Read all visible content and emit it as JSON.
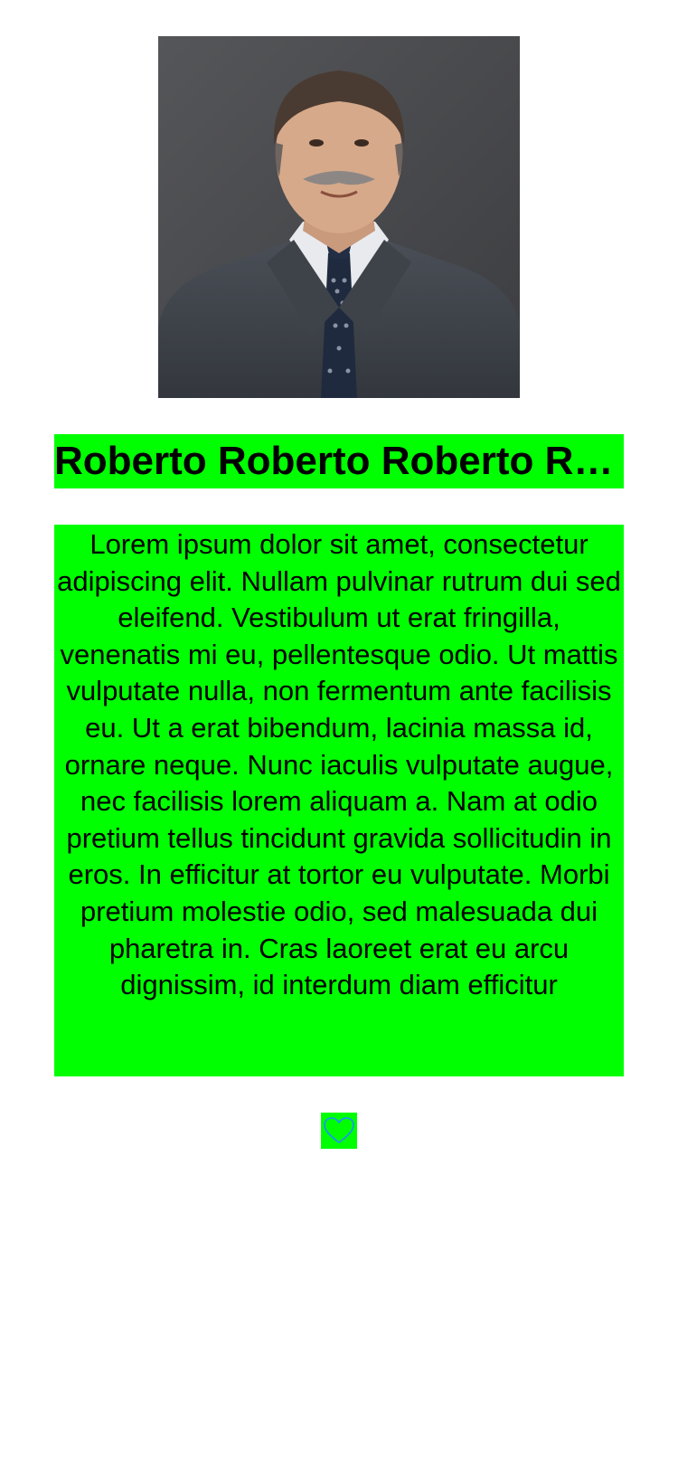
{
  "profile": {
    "photo_alt": "profile photo",
    "name": "Roberto Roberto Roberto Roberto",
    "bio": "Lorem ipsum dolor sit amet, consectetur adipiscing elit. Nullam pulvinar rutrum dui sed eleifend. Vestibulum ut erat fringilla, venenatis mi eu, pellentesque odio. Ut mattis vulputate nulla, non fermentum ante facilisis eu. Ut a erat bibendum, lacinia massa id, ornare neque. Nunc iaculis vulputate augue, nec facilisis lorem aliquam a. Nam at odio pretium tellus tincidunt gravida sollicitudin in eros. In efficitur at tortor eu vulputate. Morbi pretium molestie odio, sed malesuada dui pharetra in. Cras laoreet erat eu arcu dignissim, id interdum diam efficitur"
  },
  "like_button": {
    "icon": "heart-outline-icon",
    "icon_color": "#1e90ff"
  },
  "colors": {
    "highlight": "#00ff00",
    "background": "#ffffff",
    "text": "#000000"
  }
}
